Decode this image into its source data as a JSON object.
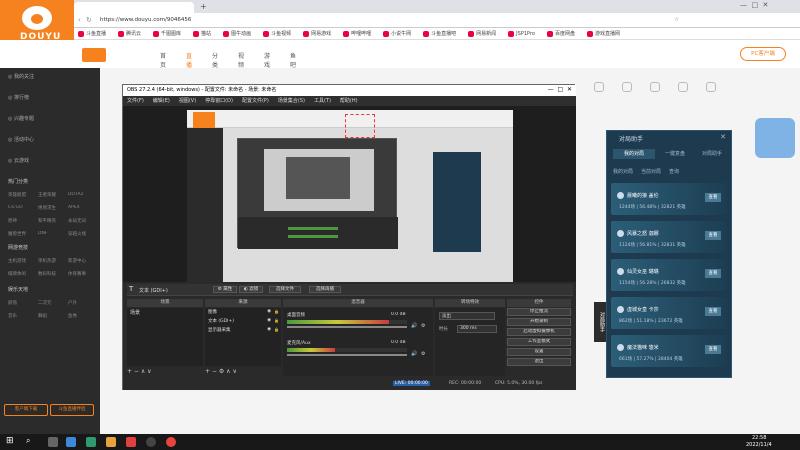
{
  "brand": {
    "logo_text": "DOUYU",
    "accent": "#f5821f"
  },
  "browser": {
    "tab_title": "",
    "url": "https://www.douyu.com/9046456",
    "bookmarks": [
      "斗鱼直播",
      "腾讯云",
      "千图图库",
      "猫站",
      "图牛动画",
      "斗鱼视频",
      "网易游戏",
      "哔哩哔哩",
      "小说牛网",
      "斗鱼直播吧",
      "网易新闻",
      "JSP1Pro",
      "百度网盘",
      "游戏直播网"
    ]
  },
  "site_nav": [
    "首页",
    "直播",
    "分类",
    "视频",
    "游戏",
    "鱼吧"
  ],
  "site_header_right": "PC客户端",
  "sidebar": {
    "items": [
      "我的关注",
      "排行榜",
      "兴趣专题",
      "活动中心",
      "云游戏"
    ],
    "section_hot": "热门分类",
    "hot_games": [
      "英雄联盟",
      "王者荣耀",
      "DOTA2",
      "CS:GO",
      "绝地求生",
      "APEX",
      "原神",
      "和平精英",
      "永劫无间",
      "魔兽世界",
      "DNF",
      "穿越火线"
    ],
    "section_games": "网游竞技",
    "games2": [
      "主机游戏",
      "单机热游",
      "新游中心",
      "棋牌休闲",
      "数码科技",
      "体育赛事"
    ],
    "section_ent": "娱乐天地",
    "ent": [
      "颜值",
      "二次元",
      "户外",
      "音乐",
      "舞蹈",
      "鱼秀"
    ],
    "bottom_btns": [
      "客户端下载",
      "斗鱼直播伴侣"
    ]
  },
  "obs": {
    "title": "OBS 27.2.4 (64-bit, windows) - 配置文件: 未命名 - 场景: 未命名",
    "menu": [
      "文件(F)",
      "编辑(E)",
      "视图(V)",
      "停靠窗口(D)",
      "配置文件(P)",
      "场景集合(S)",
      "工具(T)",
      "帮助(H)"
    ],
    "source_bar": {
      "label": "文本 (GDI+)",
      "props": "属性",
      "filters": "滤镜",
      "file": "选择文件",
      "scroll": "选择再播"
    },
    "docks": [
      "场景",
      "来源",
      "混音器",
      "转场特效",
      "控件"
    ],
    "scenes": [
      "场景"
    ],
    "sources": [
      "图像",
      "文本 (GDI+)",
      "显示器采集"
    ],
    "mixer": [
      {
        "name": "桌面音频",
        "db": "0.0 dB",
        "level": 0.85
      },
      {
        "name": "麦克风/Aux",
        "db": "0.0 dB",
        "level": 0.4
      }
    ],
    "transition": {
      "type": "淡出",
      "duration_label": "时长",
      "duration": "300 ms"
    },
    "controls": [
      "停止推流",
      "开始录制",
      "启动虚拟摄像机",
      "工作室模式",
      "设置",
      "退出"
    ],
    "status": {
      "live": "LIVE: 00:00:00",
      "rec": "REC: 00:00:00",
      "cpu": "CPU: 5.0%, 30.00 fps"
    }
  },
  "right_panel": {
    "title": "对局助手",
    "tabs": [
      "我的对局",
      "一键复盘",
      "对局助手"
    ],
    "sub_tabs": [
      "我的对局",
      "当前对局",
      "查询"
    ],
    "cards": [
      {
        "name": "晨曦的狼 盖伦",
        "stats": "1244场 | 56.48% | 32821 英雄"
      },
      {
        "name": "风暴之怒 迦娜",
        "stats": "1124场 | 56.81% | 32831 英雄"
      },
      {
        "name": "仙灵女巫 璐璐",
        "stats": "1154场 | 56.28% | 26832 英雄"
      },
      {
        "name": "虚城女皇 卡莎",
        "stats": "862场 | 51.18% | 23672 英雄"
      },
      {
        "name": "魔法猫咪 悠米",
        "stats": "661场 | 57.27% | 28404 英雄"
      }
    ],
    "card_btn": "查看",
    "side_label": "对局助手"
  },
  "taskbar": {
    "time": "22:58",
    "date": "2022/11/4"
  }
}
